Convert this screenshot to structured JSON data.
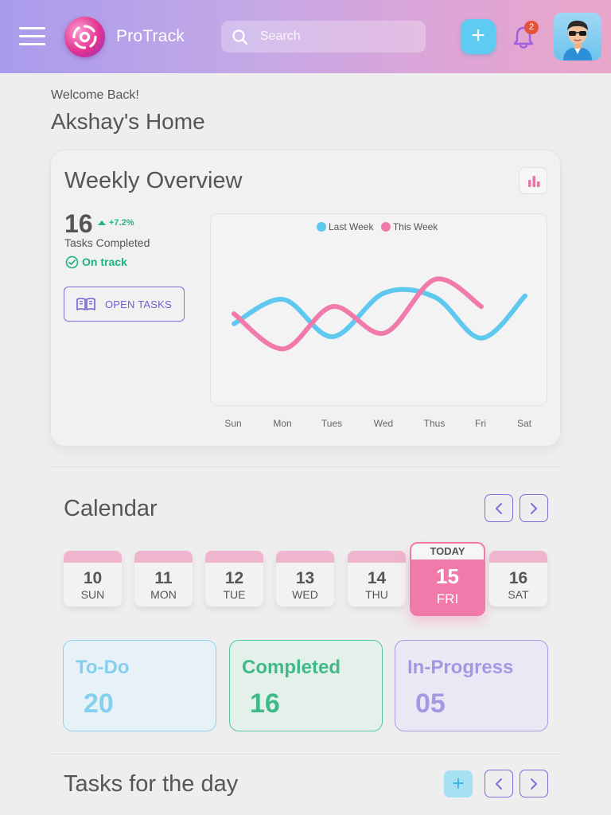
{
  "header": {
    "app_name": "ProTrack",
    "search_placeholder": "Search",
    "notification_count": "2",
    "add_label": "+"
  },
  "welcome": {
    "greeting": "Welcome Back!",
    "title": "Akshay's Home"
  },
  "overview": {
    "title": "Weekly Overview",
    "tasks_completed": "16",
    "trend": "+7.2%",
    "tasks_label": "Tasks Completed",
    "status": "On track",
    "open_tasks_label": "OPEN TASKS",
    "legend": [
      {
        "name": "Last Week",
        "color": "#5ec8ef"
      },
      {
        "name": "This Week",
        "color": "#f07aa9"
      }
    ],
    "days": [
      "Sun",
      "Mon",
      "Tues",
      "Wed",
      "Thus",
      "Fri",
      "Sat"
    ]
  },
  "chart_data": {
    "type": "line",
    "x": [
      "Sun",
      "Mon",
      "Tues",
      "Wed",
      "Thus",
      "Fri",
      "Sat"
    ],
    "series": [
      {
        "name": "Last Week",
        "color": "#5ec8ef",
        "values": [
          0.38,
          0.72,
          0.2,
          0.81,
          0.75,
          0.18,
          0.77
        ]
      },
      {
        "name": "This Week",
        "color": "#f07aa9",
        "values": [
          0.52,
          0.03,
          0.62,
          0.25,
          1.0,
          0.62,
          null
        ]
      }
    ],
    "xlabel": "",
    "ylabel": "",
    "legend": "top-center",
    "grid": false
  },
  "calendar": {
    "title": "Calendar",
    "today_caption": "TODAY",
    "days": [
      {
        "num": "10",
        "dow": "SUN"
      },
      {
        "num": "11",
        "dow": "MON"
      },
      {
        "num": "12",
        "dow": "TUE"
      },
      {
        "num": "13",
        "dow": "WED"
      },
      {
        "num": "14",
        "dow": "THU"
      },
      {
        "num": "15",
        "dow": "FRI"
      },
      {
        "num": "16",
        "dow": "SAT"
      }
    ]
  },
  "stats": {
    "todo": {
      "label": "To-Do",
      "value": "20"
    },
    "completed": {
      "label": "Completed",
      "value": "16"
    },
    "in_progress": {
      "label": "In-Progress",
      "value": "05"
    }
  },
  "tasks": {
    "title": "Tasks for the day",
    "add_label": "+"
  }
}
